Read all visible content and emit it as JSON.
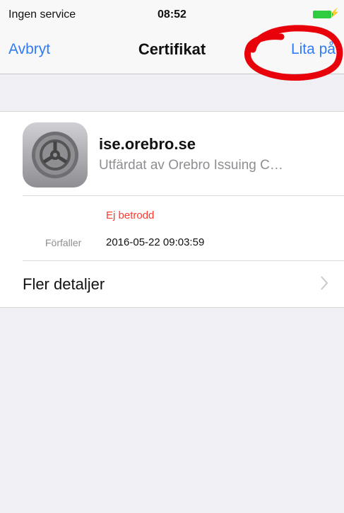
{
  "status_bar": {
    "carrier": "Ingen service",
    "time": "08:52"
  },
  "nav": {
    "cancel_label": "Avbryt",
    "title": "Certifikat",
    "trust_label": "Lita på"
  },
  "certificate": {
    "name": "ise.orebro.se",
    "issuer": "Utfärdat av Orebro Issuing C…",
    "trust_status": "Ej betrodd",
    "expires_label": "Förfaller",
    "expires_value": "2016-05-22 09:03:59",
    "more_details_label": "Fler detaljer"
  },
  "colors": {
    "accent": "#2f7cf6",
    "danger": "#ff3b30",
    "background": "#efeff4",
    "annotation": "#e8000a"
  }
}
